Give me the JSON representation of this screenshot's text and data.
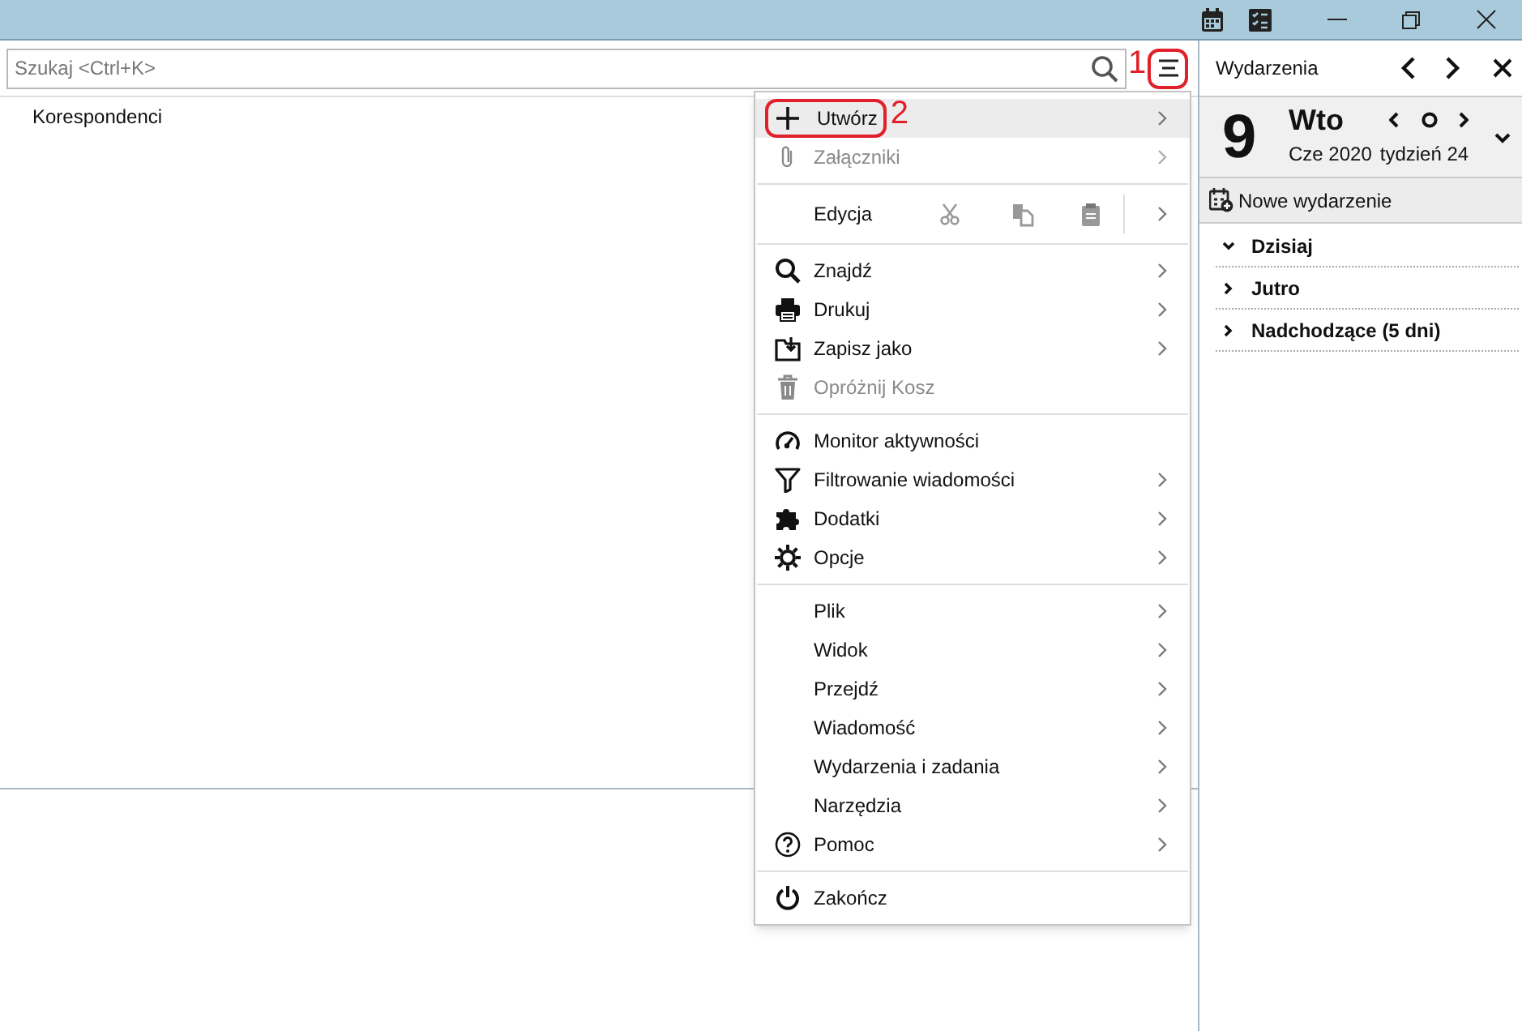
{
  "search": {
    "placeholder": "Szukaj <Ctrl+K>"
  },
  "menu_button": {
    "annotation": "1"
  },
  "thread_list": {
    "columns": [
      "Korespondenci"
    ]
  },
  "menu": {
    "sections": [
      [
        {
          "kind": "item",
          "label": "Utwórz",
          "submenu": true,
          "disabled": false,
          "selected": true,
          "annotation": "2"
        },
        {
          "kind": "item",
          "label": "Załączniki",
          "submenu": true,
          "disabled": true,
          "selected": false
        }
      ],
      [
        {
          "kind": "edit",
          "label": "Edycja",
          "submenu": true,
          "disabled": false,
          "selected": false
        }
      ],
      [
        {
          "kind": "item",
          "label": "Znajdź",
          "submenu": true,
          "disabled": false,
          "selected": false
        },
        {
          "kind": "item",
          "label": "Drukuj",
          "submenu": true,
          "disabled": false,
          "selected": false
        },
        {
          "kind": "item",
          "label": "Zapisz jako",
          "submenu": true,
          "disabled": false,
          "selected": false
        },
        {
          "kind": "item",
          "label": "Opróżnij Kosz",
          "submenu": false,
          "disabled": true,
          "selected": false
        }
      ],
      [
        {
          "kind": "item",
          "label": "Monitor aktywności",
          "submenu": false,
          "disabled": false,
          "selected": false
        },
        {
          "kind": "item",
          "label": "Filtrowanie wiadomości",
          "submenu": true,
          "disabled": false,
          "selected": false
        },
        {
          "kind": "item",
          "label": "Dodatki",
          "submenu": true,
          "disabled": false,
          "selected": false
        },
        {
          "kind": "item",
          "label": "Opcje",
          "submenu": true,
          "disabled": false,
          "selected": false
        }
      ],
      [
        {
          "kind": "item",
          "label": "Plik",
          "submenu": true,
          "disabled": false,
          "selected": false
        },
        {
          "kind": "item",
          "label": "Widok",
          "submenu": true,
          "disabled": false,
          "selected": false
        },
        {
          "kind": "item",
          "label": "Przejdź",
          "submenu": true,
          "disabled": false,
          "selected": false
        },
        {
          "kind": "item",
          "label": "Wiadomość",
          "submenu": true,
          "disabled": false,
          "selected": false
        },
        {
          "kind": "item",
          "label": "Wydarzenia i zadania",
          "submenu": true,
          "disabled": false,
          "selected": false
        },
        {
          "kind": "item",
          "label": "Narzędzia",
          "submenu": true,
          "disabled": false,
          "selected": false
        },
        {
          "kind": "item",
          "label": "Pomoc",
          "submenu": true,
          "disabled": false,
          "selected": false
        }
      ],
      [
        {
          "kind": "item",
          "label": "Zakończ",
          "submenu": false,
          "disabled": false,
          "selected": false
        }
      ]
    ]
  },
  "today_pane": {
    "title": "Wydarzenia",
    "day": "9",
    "weekday": "Wto",
    "month_year": "Cze 2020",
    "week": "tydzień 24",
    "new_event": "Nowe wydarzenie",
    "sections": [
      {
        "label": "Dzisiaj",
        "expanded": true
      },
      {
        "label": "Jutro",
        "expanded": false
      },
      {
        "label": "Nadchodzące (5 dni)",
        "expanded": false
      }
    ]
  }
}
